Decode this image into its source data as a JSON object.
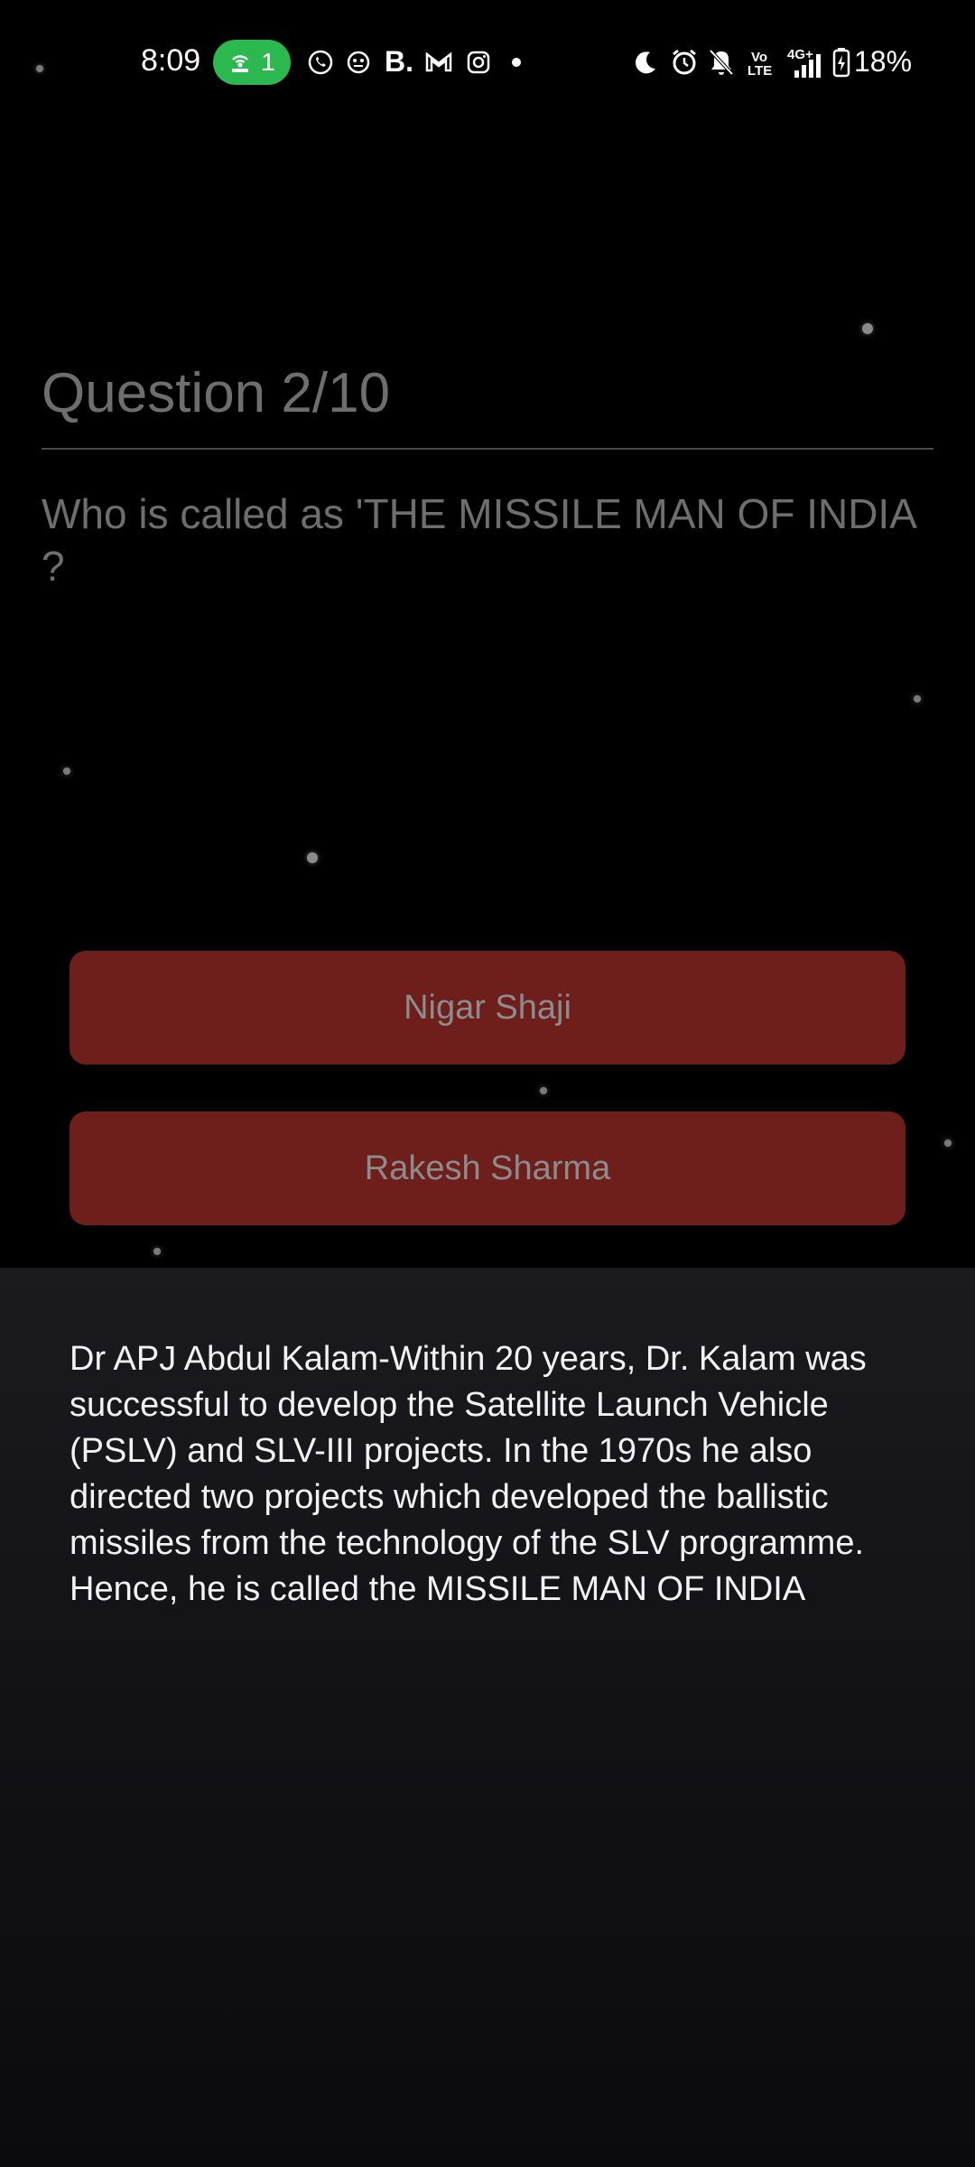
{
  "status_bar": {
    "time": "8:09",
    "hotspot_count": "1",
    "battery": "18%",
    "signal_label": "4G+",
    "volte_label": "Vo LTE",
    "bold_b": "B."
  },
  "quiz": {
    "counter": "Question 2/10",
    "question": "Who is called as 'THE MISSILE MAN OF INDIA ?",
    "answers": [
      {
        "label": "Nigar Shaji"
      },
      {
        "label": "Rakesh Sharma"
      }
    ],
    "answer_color": "#6e1f1b"
  },
  "explanation": {
    "text": "Dr APJ Abdul Kalam-Within 20 years, Dr. Kalam was successful to develop the Satellite Launch Vehicle (PSLV) and SLV-III projects. In the 1970s he also directed two projects which developed the ballistic missiles from the technology of the SLV programme. Hence, he is called the MISSILE MAN OF INDIA"
  },
  "colors": {
    "background": "#000000",
    "hotspot_green": "#2bb84f",
    "sheet_background": "#1b1b1f"
  }
}
